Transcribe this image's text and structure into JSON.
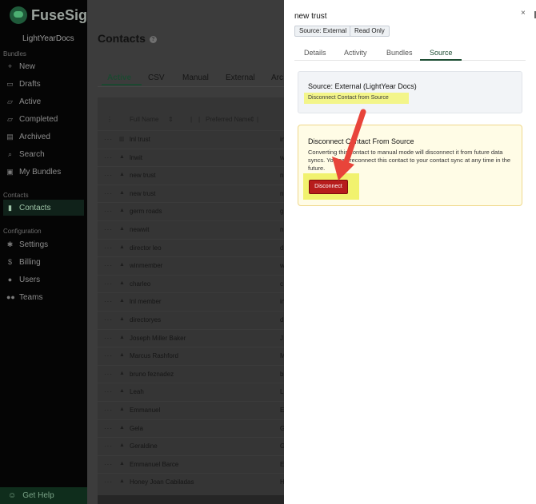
{
  "sidebar": {
    "logo_text": "FuseSign",
    "org_name": "LightYearDocs",
    "sections": {
      "bundles": "Bundles",
      "contacts": "Contacts",
      "configuration": "Configuration"
    },
    "items": [
      {
        "label": "New",
        "icon": "plus-icon"
      },
      {
        "label": "Drafts",
        "icon": "inbox-icon"
      },
      {
        "label": "Active",
        "icon": "folder-icon"
      },
      {
        "label": "Completed",
        "icon": "folder-icon"
      },
      {
        "label": "Archived",
        "icon": "archive-icon"
      },
      {
        "label": "Search",
        "icon": "search-icon"
      },
      {
        "label": "My Bundles",
        "icon": "user-folder-icon"
      },
      {
        "label": "Contacts",
        "icon": "contact-book-icon"
      },
      {
        "label": "Settings",
        "icon": "gear-icon"
      },
      {
        "label": "Billing",
        "icon": "dollar-icon"
      },
      {
        "label": "Users",
        "icon": "user-icon"
      },
      {
        "label": "Teams",
        "icon": "users-icon"
      }
    ],
    "help_label": "Get Help"
  },
  "main": {
    "title": "Contacts",
    "tabs": [
      "Active",
      "CSV",
      "Manual",
      "External",
      "Arc"
    ],
    "columns": [
      "Full Name",
      "Preferred Name"
    ],
    "rows": [
      {
        "name": "lnl trust",
        "icon": "building-icon",
        "extra": "in"
      },
      {
        "name": "lnwit",
        "icon": "person-icon",
        "extra": "w"
      },
      {
        "name": "new trust",
        "icon": "person-icon",
        "extra": "n"
      },
      {
        "name": "new trust",
        "icon": "person-icon",
        "extra": "n"
      },
      {
        "name": "germ roads",
        "icon": "person-icon",
        "extra": "g"
      },
      {
        "name": "newwit",
        "icon": "person-icon",
        "extra": "n"
      },
      {
        "name": "director leo",
        "icon": "person-icon",
        "extra": "d"
      },
      {
        "name": "winmember",
        "icon": "person-icon",
        "extra": "w"
      },
      {
        "name": "charleo",
        "icon": "person-icon",
        "extra": "c"
      },
      {
        "name": "lnl member",
        "icon": "person-icon",
        "extra": "in"
      },
      {
        "name": "directoryes",
        "icon": "person-icon",
        "extra": "d"
      },
      {
        "name": "Joseph Miller Baker",
        "icon": "person-icon",
        "extra": "J"
      },
      {
        "name": "Marcus Rashford",
        "icon": "person-icon",
        "extra": "M"
      },
      {
        "name": "bruno feznadez",
        "icon": "person-icon",
        "extra": "b"
      },
      {
        "name": "Leah",
        "icon": "person-icon",
        "extra": "L"
      },
      {
        "name": "Emmanuel",
        "icon": "person-icon",
        "extra": "E"
      },
      {
        "name": "Gela",
        "icon": "person-icon",
        "extra": "G"
      },
      {
        "name": "Geraldine",
        "icon": "person-icon",
        "extra": "G"
      },
      {
        "name": "Emmanuel Barce",
        "icon": "person-icon",
        "extra": "E"
      },
      {
        "name": "Honey Joan Cabiladas",
        "icon": "person-icon",
        "extra": "H"
      }
    ]
  },
  "drawer": {
    "title": "new trust",
    "close_label": "×",
    "badges": [
      "Source: External",
      "Read Only"
    ],
    "tabs": [
      "Details",
      "Activity",
      "Bundles",
      "Source"
    ],
    "active_tab": "Source",
    "source_card": {
      "title": "Source: External (LightYear Docs)",
      "link": "Disconnect Contact from Source"
    },
    "confirm_card": {
      "title": "Disconnect Contact From Source",
      "text": "Converting this contact to manual mode will disconnect it from future data syncs. You can reconnect this contact to your contact sync at any time in the future.",
      "button": "Disconnect"
    }
  },
  "colors": {
    "accent": "#1d4d33",
    "danger": "#b71c1c",
    "highlight": "#f3f58a",
    "arrow": "#e8443a"
  }
}
